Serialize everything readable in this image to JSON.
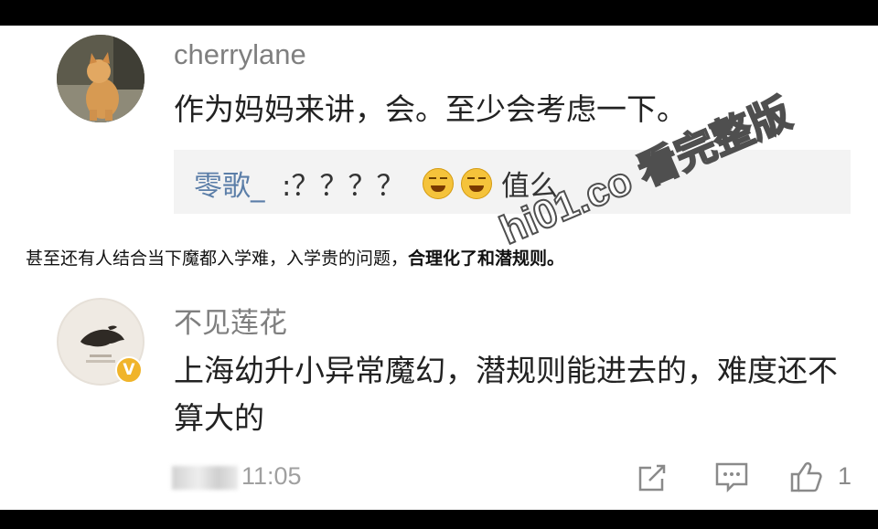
{
  "comment1": {
    "username": "cherrylane",
    "text": "作为妈妈来讲，会。至少会考虑一下。",
    "reply": {
      "author": "零歌_",
      "text": ":？？？？",
      "emoji": [
        "grinning-sweat-emoji",
        "grinning-sweat-emoji"
      ],
      "tail": "值么"
    }
  },
  "caption": {
    "normal": "甚至还有人结合当下魔都入学难，入学贵的问题，",
    "bold": "合理化了和潜规则。"
  },
  "watermark": "hi01.co 看完整版",
  "comment2": {
    "username": "不见莲花",
    "text": "上海幼升小异常魔幻，潜规则能进去的，难度还不算大的",
    "verified_badge": "V",
    "time": "11:05",
    "like_count": "1"
  },
  "colors": {
    "username": "#7f7f7f",
    "reply_author": "#5b7ea8",
    "verified": "#f0b42a"
  }
}
